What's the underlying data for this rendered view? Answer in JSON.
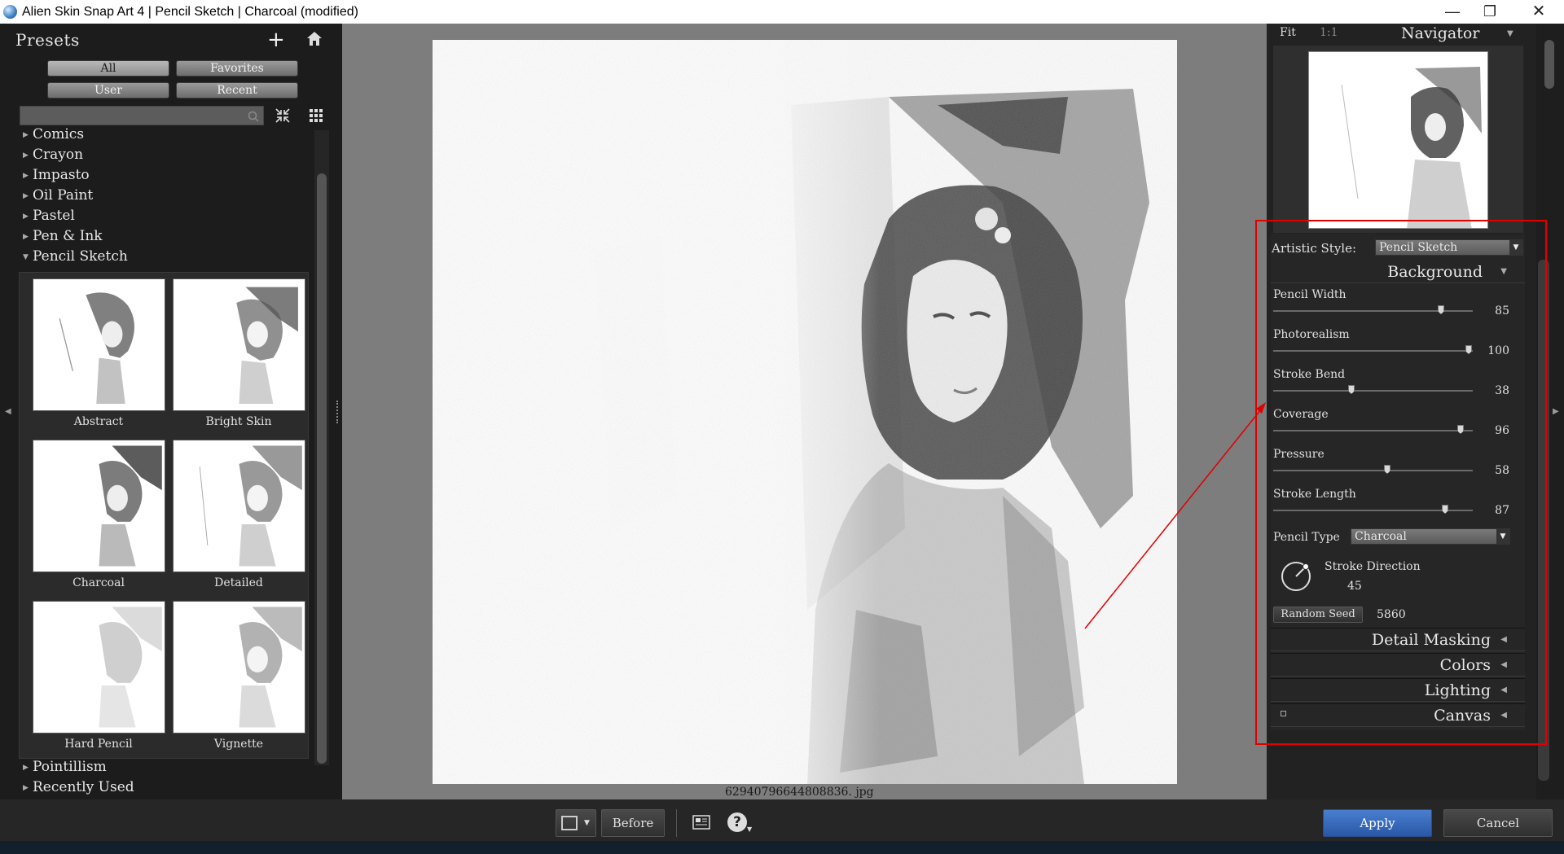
{
  "window": {
    "title": "Alien Skin Snap Art 4 | Pencil Sketch | Charcoal (modified)"
  },
  "presets": {
    "title": "Presets",
    "filters": [
      "All",
      "Favorites",
      "User",
      "Recent"
    ],
    "categories_top": [
      "Comics",
      "Crayon",
      "Impasto",
      "Oil Paint",
      "Pastel",
      "Pen & Ink",
      "Pencil Sketch"
    ],
    "thumbnails": [
      "Abstract",
      "Bright Skin",
      "Charcoal",
      "Detailed",
      "Hard Pencil",
      "Vignette"
    ],
    "categories_bottom": [
      "Pointillism",
      "Recently Used"
    ]
  },
  "canvas": {
    "filename": "62940796644808836. jpg"
  },
  "navigator": {
    "fit": "Fit",
    "one_to_one": "1:1",
    "title": "Navigator"
  },
  "settings": {
    "artistic_style_label": "Artistic Style:",
    "artistic_style_value": "Pencil Sketch",
    "background_title": "Background",
    "sliders": [
      {
        "label": "Pencil Width",
        "value": 85,
        "fraction": 0.84
      },
      {
        "label": "Photorealism",
        "value": 100,
        "fraction": 0.98
      },
      {
        "label": "Stroke Bend",
        "value": 38,
        "fraction": 0.39
      },
      {
        "label": "Coverage",
        "value": 96,
        "fraction": 0.94
      },
      {
        "label": "Pressure",
        "value": 58,
        "fraction": 0.57
      },
      {
        "label": "Stroke Length",
        "value": 87,
        "fraction": 0.86
      }
    ],
    "pencil_type_label": "Pencil Type",
    "pencil_type_value": "Charcoal",
    "stroke_direction_label": "Stroke Direction",
    "stroke_direction_value": "45",
    "random_seed_label": "Random Seed",
    "random_seed_value": "5860",
    "sections": [
      "Detail Masking",
      "Colors",
      "Lighting",
      "Canvas"
    ]
  },
  "bottom": {
    "before": "Before",
    "apply": "Apply",
    "cancel": "Cancel"
  },
  "colors": {
    "accent": "#2f63b8",
    "annotation": "#e00000"
  }
}
